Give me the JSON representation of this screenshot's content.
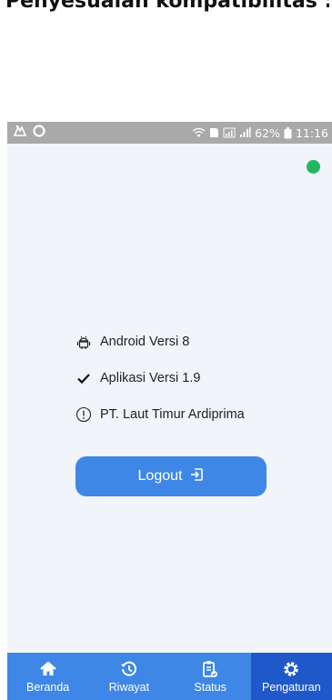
{
  "caption": "Penyesuaian kompatibilitas :",
  "status_bar": {
    "battery": "62%",
    "time": "11:16"
  },
  "info": [
    {
      "icon": "android-icon",
      "text": "Android Versi 8"
    },
    {
      "icon": "check-icon",
      "text": "Aplikasi Versi 1.9"
    },
    {
      "icon": "info-circle-icon",
      "text": "PT. Laut Timur Ardiprima"
    }
  ],
  "logout": {
    "label": "Logout",
    "icon": "sign-out-icon"
  },
  "nav": [
    {
      "label": "Beranda",
      "icon": "home-icon",
      "active": false
    },
    {
      "label": "Riwayat",
      "icon": "history-icon",
      "active": false
    },
    {
      "label": "Status",
      "icon": "clipboard-check-icon",
      "active": false
    },
    {
      "label": "Pengaturan",
      "icon": "gear-icon",
      "active": true
    }
  ],
  "colors": {
    "primary": "#3e87e6",
    "nav_active": "#1f58c9",
    "online": "#22b861",
    "screen_bg": "#f1f4f9",
    "status_bar": "#a9a9a9"
  }
}
